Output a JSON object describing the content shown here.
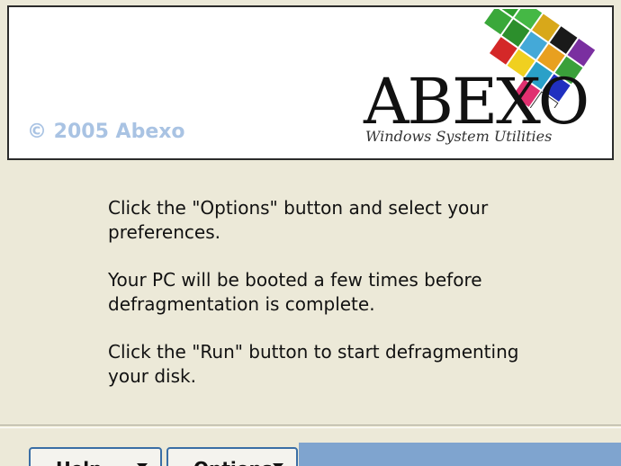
{
  "banner": {
    "copyright": "© 2005 Abexo",
    "logo_name": "ABEXO",
    "logo_tagline": "Windows System Utilities"
  },
  "instructions": [
    "Click the \"Options\" button and select your preferences.",
    "Your PC will be booted a few times before defragmentation is complete.",
    "Click the \"Run\" button to start defragmenting your disk."
  ],
  "buttons": {
    "help_label": "Help",
    "options_label": "Options"
  },
  "colors": {
    "window_bg": "#ece9d8",
    "copyright_text": "#a9c3e3",
    "button_border": "#3a6ea5",
    "run_panel": "#7fa4cf"
  }
}
